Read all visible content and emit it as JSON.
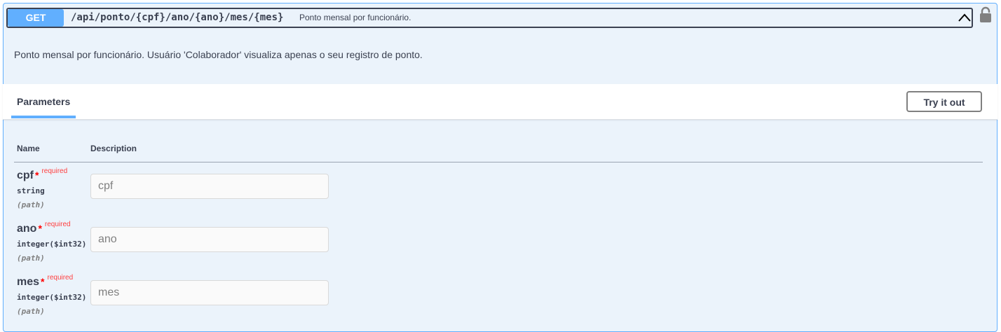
{
  "operation": {
    "method": "GET",
    "path": "/api/ponto/{cpf}/ano/{ano}/mes/{mes}",
    "summary": "Ponto mensal por funcionário.",
    "description": "Ponto mensal por funcionário. Usuário 'Colaborador' visualiza apenas o seu registro de ponto.",
    "method_color": "#61affe",
    "background_color": "#ebf3fb"
  },
  "params_section": {
    "tab_label": "Parameters",
    "try_button_label": "Try it out",
    "col_name": "Name",
    "col_description": "Description"
  },
  "parameters": [
    {
      "name": "cpf",
      "star": "*",
      "required": "required",
      "type": "string",
      "in": "(path)",
      "placeholder": "cpf"
    },
    {
      "name": "ano",
      "star": "*",
      "required": "required",
      "type": "integer($int32)",
      "in": "(path)",
      "placeholder": "ano"
    },
    {
      "name": "mes",
      "star": "*",
      "required": "required",
      "type": "integer($int32)",
      "in": "(path)",
      "placeholder": "mes"
    }
  ]
}
